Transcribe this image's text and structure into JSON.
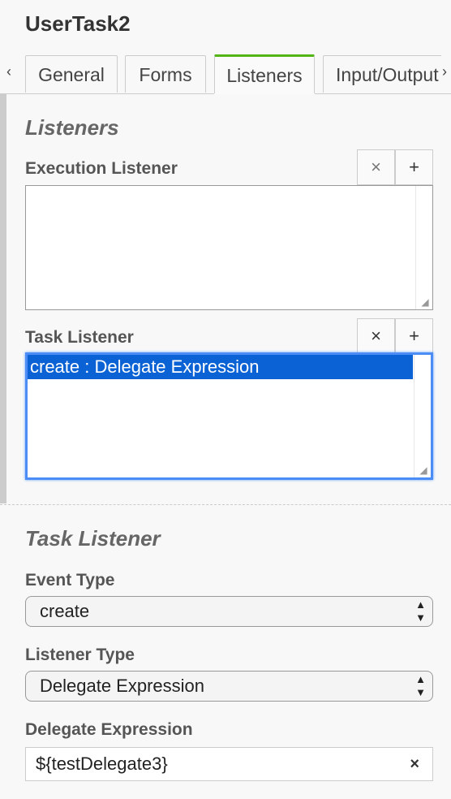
{
  "header": {
    "title": "UserTask2"
  },
  "tabs": {
    "prev_arrow": "‹",
    "next_arrow": "›",
    "items": [
      {
        "label": "General"
      },
      {
        "label": "Forms"
      },
      {
        "label": "Listeners",
        "active": true
      },
      {
        "label": "Input/Output"
      }
    ]
  },
  "listeners": {
    "section_title": "Listeners",
    "execution": {
      "label": "Execution Listener",
      "remove_label": "×",
      "add_label": "+",
      "items": []
    },
    "task": {
      "label": "Task Listener",
      "remove_label": "×",
      "add_label": "+",
      "items": [
        {
          "text": "create : Delegate Expression",
          "selected": true
        }
      ]
    }
  },
  "detail": {
    "section_title": "Task Listener",
    "event_type": {
      "label": "Event Type",
      "value": "create"
    },
    "listener_type": {
      "label": "Listener Type",
      "value": "Delegate Expression"
    },
    "delegate_expression": {
      "label": "Delegate Expression",
      "value": "${testDelegate3}",
      "clear_label": "×"
    }
  },
  "colors": {
    "accent_tab": "#52b415",
    "focus": "#4b8cf5",
    "selection": "#0a62d4"
  }
}
